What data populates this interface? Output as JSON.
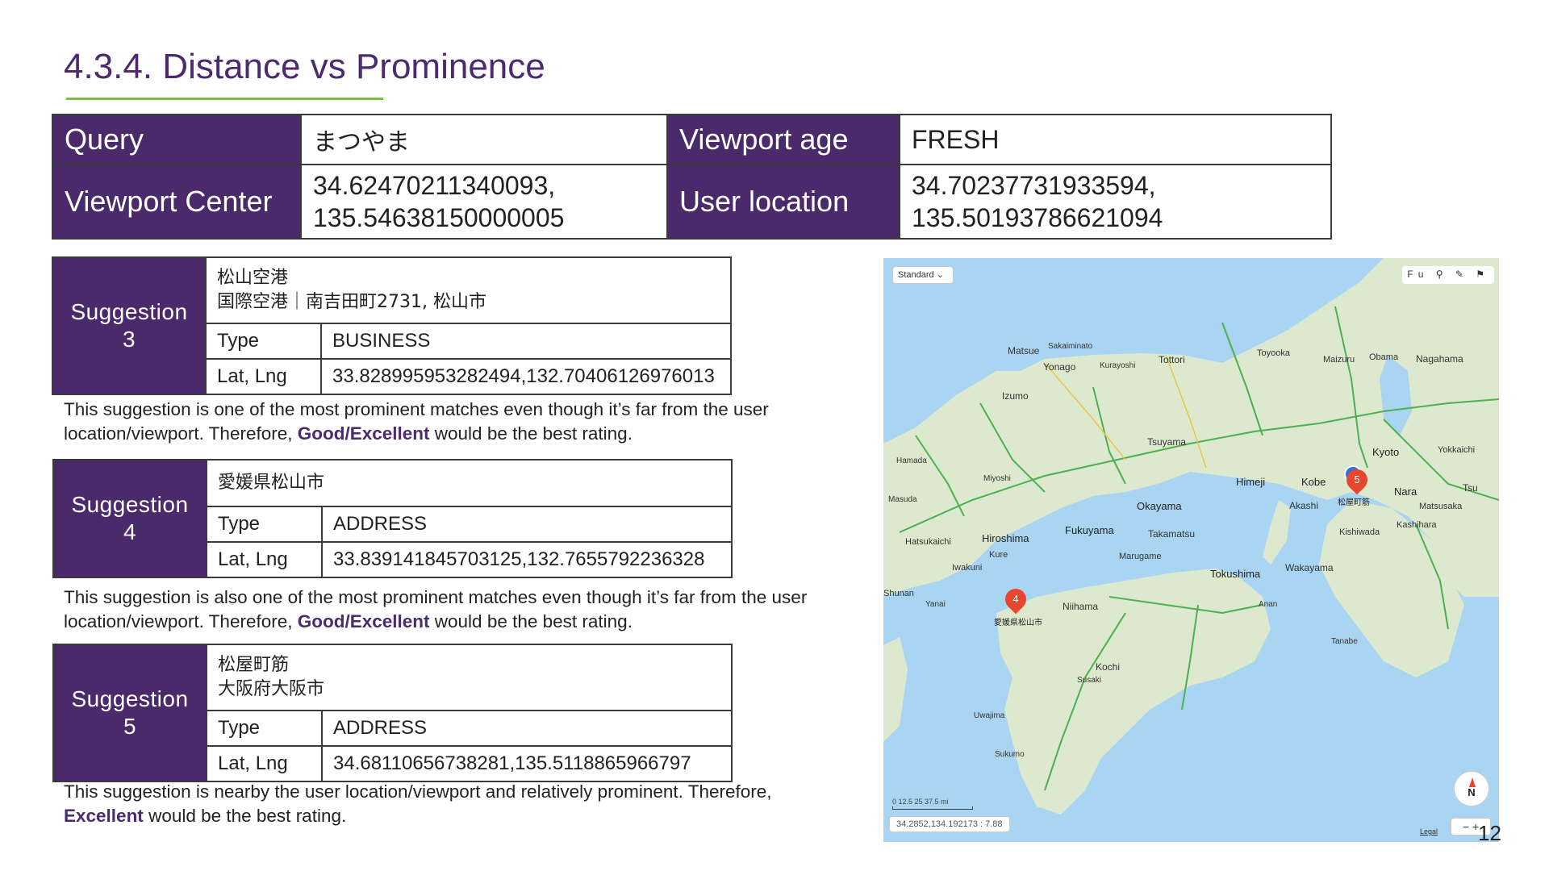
{
  "title": "4.3.4. Distance vs Prominence",
  "info": {
    "query_label": "Query",
    "query_value": "まつやま",
    "viewport_age_label": "Viewport age",
    "viewport_age_value": "FRESH",
    "viewport_center_label": "Viewport Center",
    "viewport_center_lat": "34.62470211340093,",
    "viewport_center_lng": "135.54638150000005",
    "user_location_label": "User location",
    "user_location_lat": "34.70237731933594,",
    "user_location_lng": "135.50193786621094"
  },
  "suggestions": [
    {
      "header_line1": "Suggestion",
      "header_line2": "3",
      "name_line1": "松山空港",
      "name_line2": "国際空港｜南吉田町2731, 松山市",
      "type_label": "Type",
      "type_value": "BUSINESS",
      "latlng_label": "Lat, Lng",
      "latlng_value": "33.828995953282494,132.70406126976013",
      "note_pre": "This suggestion is one of the most prominent matches even though it’s far from the user location/viewport. Therefore, ",
      "note_bold": "Good/Excellent",
      "note_post": " would be the best rating."
    },
    {
      "header_line1": "Suggestion",
      "header_line2": "4",
      "name_line1": "愛媛県松山市",
      "type_label": "Type",
      "type_value": "ADDRESS",
      "latlng_label": "Lat, Lng",
      "latlng_value": "33.839141845703125,132.7655792236328",
      "note_pre": "This suggestion is also one of the most prominent matches even though it’s far from the user location/viewport. Therefore, ",
      "note_bold": "Good/Excellent",
      "note_post": " would be the best rating."
    },
    {
      "header_line1": "Suggestion",
      "header_line2": "5",
      "name_line1": "松屋町筋",
      "name_line2": "大阪府大阪市",
      "type_label": "Type",
      "type_value": "ADDRESS",
      "latlng_label": "Lat, Lng",
      "latlng_value": "34.68110656738281,135.5118865966797",
      "note_pre": "This suggestion is nearby the user location/viewport and relatively prominent. Therefore, ",
      "note_bold": "Excellent",
      "note_post": " would be the best rating."
    }
  ],
  "map": {
    "style_select": "Standard ⌄",
    "tools": "Fu ⚲ ✎ ⚑",
    "pin4_number": "4",
    "pin4_label": "愛媛県松山市",
    "pin5_number": "5",
    "pin5_label": "松屋町筋",
    "coord_readout": "34.2852,134.192173 : 7.88",
    "scale_label": "0    12.5    25    37.5 mi",
    "compass": "N",
    "legal": "Legal",
    "zoom": "− +",
    "places": {
      "matsue": "Matsue",
      "sakaiminato": "Sakaiminato",
      "yonago": "Yonago",
      "kurayoshi": "Kurayoshi",
      "tottori": "Tottori",
      "toyooka": "Toyooka",
      "maizuru": "Maizuru",
      "obama": "Obama",
      "nagahama": "Nagahama",
      "izumo": "Izumo",
      "tsuyama": "Tsuyama",
      "himeji": "Himeji",
      "kobe": "Kobe",
      "kyoto": "Kyoto",
      "nara": "Nara",
      "osaka_akashi": "Akashi",
      "hiroshima": "Hiroshima",
      "fukuyama": "Fukuyama",
      "okayama": "Okayama",
      "takamatsu": "Takamatsu",
      "tokushima": "Tokushima",
      "wakayama": "Wakayama",
      "kure": "Kure",
      "iwakuni": "Iwakuni",
      "niihama": "Niihama",
      "kochi": "Kochi",
      "susaki": "Susaki",
      "uwajima": "Uwajima",
      "sukumo": "Sukumo",
      "hamada": "Hamada",
      "masuda": "Masuda",
      "miyoshi": "Miyoshi",
      "hatsukaichi": "Hatsukaichi",
      "marugame": "Marugame",
      "kishiwada": "Kishiwada",
      "kashihara": "Kashihara",
      "tsu": "Tsu",
      "matsusaka": "Matsusaka",
      "yokkaichi": "Yokkaichi",
      "anan": "Anan",
      "tanabe": "Tanabe",
      "shunan": "Shunan",
      "yanai": "Yanai"
    }
  },
  "page_number": "12"
}
